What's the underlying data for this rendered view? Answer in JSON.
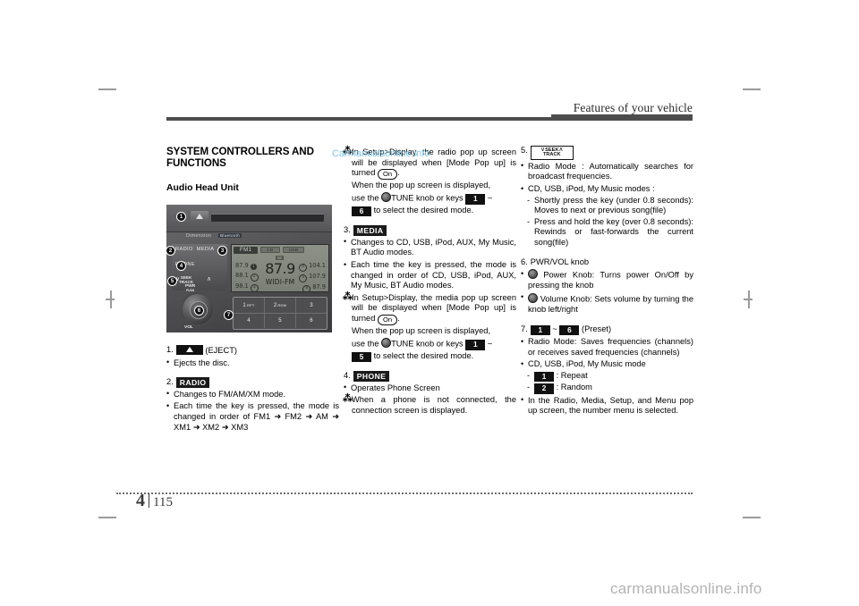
{
  "header": {
    "title": "Features of your vehicle"
  },
  "footer": {
    "chapter": "4",
    "page_number": "115",
    "watermark": "carmanualsonline.info"
  },
  "watermark_top": "Carmanualsonline.info",
  "col1": {
    "section_title": "SYSTEM CONTROLLERS AND FUNCTIONS",
    "subsection_title": "Audio Head Unit",
    "item1": {
      "number": "1.",
      "key": "eject-key",
      "label": "(EJECT)",
      "bullets": [
        "Ejects the disc."
      ]
    },
    "item2": {
      "number": "2.",
      "key_label": "RADIO",
      "bullets": [
        "Changes to FM/AM/XM mode.",
        "Each time the key is pressed, the mode is changed in order of FM1 ➜ FM2 ➜ AM ➜ XM1 ➜ XM2 ➜ XM3"
      ]
    }
  },
  "col2": {
    "item2_cont": {
      "aster": "In Setup>Display, the radio pop up screen will be displayed when [Mode Pop up] is turned",
      "pill": "On",
      "aster_tail": ".",
      "popup_line1": "When the pop up screen is displayed,",
      "popup_line2_pre": "use the",
      "popup_line2_mid": "TUNE knob or keys",
      "key_from": "1",
      "tilde": "~",
      "key_to": "6",
      "popup_line3": "to select the desired mode."
    },
    "item3": {
      "number": "3.",
      "key_label": "MEDIA",
      "bullets": [
        "Changes to CD, USB, iPod, AUX, My Music, BT Audio modes.",
        "Each time the key is pressed, the mode is changed in order of CD, USB, iPod, AUX, My Music, BT Audio modes."
      ],
      "aster": "In Setup>Display, the media pop up screen will be displayed when [Mode Pop up] is turned",
      "pill": "On",
      "popup_line1": "When the pop up screen is displayed,",
      "popup_line2_pre": "use the",
      "popup_line2_mid": "TUNE knob or keys",
      "key_from": "1",
      "tilde": "~",
      "key_to": "5",
      "popup_line3": "to select the desired mode."
    },
    "item4": {
      "number": "4.",
      "key_label": "PHONE",
      "bullets": [
        "Operates Phone Screen"
      ],
      "aster": "When a phone is not connected, the connection screen is displayed."
    }
  },
  "col3": {
    "item5": {
      "number": "5.",
      "key_seek_top": "SEEK",
      "key_seek_bottom": "TRACK",
      "bullets": [
        "Radio Mode : Automatically searches for broadcast frequencies.",
        "CD, USB, iPod, My Music modes :"
      ],
      "dashes": [
        "Shortly press the key (under 0.8 seconds): Moves to next or previous song(file)",
        "Press and hold the key (over 0.8 seconds): Rewinds or fast-forwards the current song(file)"
      ]
    },
    "item6": {
      "number": "6.",
      "title": "PWR/VOL knob",
      "bullets": [
        "Power Knob: Turns power On/Off by pressing the knob",
        "Volume Knob: Sets volume by turning the knob left/right"
      ]
    },
    "item7": {
      "number": "7.",
      "key_from": "1",
      "tilde": "~",
      "key_to": "6",
      "label": "(Preset)",
      "bullets": [
        "Radio Mode: Saves frequencies (channels) or receives saved frequencies (channels)",
        "CD, USB, iPod, My Music mode"
      ],
      "dashes": [
        {
          "key": "1",
          "text": ": Repeat"
        },
        {
          "key": "2",
          "text": ": Random"
        }
      ],
      "bullet_last": "In the Radio, Media, Setup, and Menu pop up screen, the number menu is selected."
    }
  },
  "head_unit": {
    "brand": "Dimension",
    "bluetooth_label": "Bluetooth",
    "buttons": {
      "radio": "RADIO",
      "media": "MEDIA",
      "phone": "PHONE",
      "seek": "SEEK",
      "track": "TRACK",
      "pwr": "PWR",
      "push": "PUSH",
      "vol": "VOL"
    },
    "display": {
      "tabs": [
        "FM1",
        "CD",
        "USB"
      ],
      "stereo_indicator": "ST",
      "presets_left": [
        {
          "freq": "87.9",
          "num": "1",
          "filled": true
        },
        {
          "freq": "88.1",
          "num": "2",
          "filled": false
        },
        {
          "freq": "98.1",
          "num": "3",
          "filled": false
        }
      ],
      "presets_right": [
        {
          "num": "4",
          "freq": "104.1"
        },
        {
          "num": "5",
          "freq": "107.9"
        },
        {
          "num": "6",
          "freq": "87.9"
        }
      ],
      "big_frequency": "87.9",
      "station_name": "WIDI-FM"
    },
    "preset_pad": {
      "row1": [
        "1",
        "2",
        "3"
      ],
      "row1_sub": [
        "RPT",
        "RDM",
        ""
      ],
      "row2": [
        "4",
        "5",
        "6"
      ]
    },
    "callouts": [
      "1",
      "2",
      "3",
      "4",
      "5",
      "6",
      "7"
    ]
  }
}
